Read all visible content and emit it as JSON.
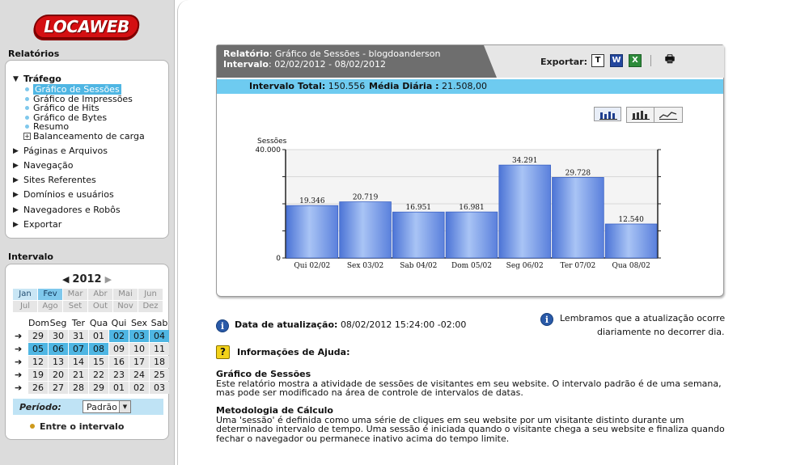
{
  "brand": {
    "logo_text": "LOCAWEB"
  },
  "sidebar": {
    "relatorios_title": "Relatórios",
    "intervalo_title": "Intervalo",
    "nav": {
      "trafego": "Tráfego",
      "sub": [
        "Gráfico de Sessões",
        "Gráfico de Impressões",
        "Gráfico de Hits",
        "Gráfico de Bytes",
        "Resumo",
        "Balanceamento de carga"
      ],
      "others": [
        "Páginas e Arquivos",
        "Navegação",
        "Sites Referentes",
        "Domínios e usuários",
        "Navegadores e Robôs",
        "Exportar"
      ]
    },
    "calendar": {
      "year": "2012",
      "months": [
        "Jan",
        "Fev",
        "Mar",
        "Abr",
        "Mai",
        "Jun",
        "Jul",
        "Ago",
        "Set",
        "Out",
        "Nov",
        "Dez"
      ],
      "weekdays": [
        "Dom",
        "Seg",
        "Ter",
        "Qua",
        "Qui",
        "Sex",
        "Sab"
      ],
      "weeks": [
        [
          "29",
          "30",
          "31",
          "01",
          "02",
          "03",
          "04"
        ],
        [
          "05",
          "06",
          "07",
          "08",
          "09",
          "10",
          "11"
        ],
        [
          "12",
          "13",
          "14",
          "15",
          "16",
          "17",
          "18"
        ],
        [
          "19",
          "20",
          "21",
          "22",
          "23",
          "24",
          "25"
        ],
        [
          "26",
          "27",
          "28",
          "29",
          "01",
          "02",
          "03"
        ]
      ],
      "periodo_label": "Período:",
      "periodo_value": "Padrão",
      "entre_label": "Entre o intervalo"
    }
  },
  "report": {
    "relatorio_label": "Relatório",
    "relatorio_value": ": Gráfico de Sessões - blogdoanderson",
    "intervalo_label": "Intervalo",
    "intervalo_value": ": 02/02/2012 - 08/02/2012",
    "exportar_label": "Exportar:",
    "export_buttons": [
      "T",
      "W",
      "X"
    ],
    "total_label": "Intervalo Total:",
    "total_value": "150.556",
    "media_label": "Média Diária :",
    "media_value": "21.508,00"
  },
  "chart_data": {
    "type": "bar",
    "ylabel": "Sessões",
    "ylim": [
      0,
      40000
    ],
    "y_ticks": [
      "40.000",
      "0"
    ],
    "categories": [
      "Qui 02/02",
      "Sex 03/02",
      "Sab 04/02",
      "Dom 05/02",
      "Seg 06/02",
      "Ter 07/02",
      "Qua 08/02"
    ],
    "values": [
      19346,
      20719,
      16951,
      16981,
      34291,
      29728,
      12540
    ],
    "value_labels": [
      "19.346",
      "20.719",
      "16.951",
      "16.981",
      "34.291",
      "29.728",
      "12.540"
    ],
    "bar_color": "#6f95e6",
    "grid": true
  },
  "info": {
    "update_label": "Data de atualização:",
    "update_value": "08/02/2012 15:24:00 -02:00",
    "reminder_line1": "Lembramos que a atualização ocorre",
    "reminder_line2": "diariamente no decorrer dia.",
    "help_title": "Informações de Ajuda:",
    "sec1_title": "Gráfico de Sessões",
    "sec1_line1": "Este relatório mostra a atividade de sessões de visitantes em seu website. O intervalo padrão é de uma semana,",
    "sec1_line2": "mas pode ser modificado na área de controle de intervalos de datas.",
    "sec2_title": "Metodologia de Cálculo",
    "sec2_line1": "Uma 'sessão' é definida como uma série de cliques em seu website por um visitante distinto durante um",
    "sec2_line2": "determinado intervalo de tempo. Uma sessão é iniciada quando o visitante chega a seu website e finaliza quando",
    "sec2_line3": "fechar o navegador ou permanece inativo acima do tempo limite."
  }
}
